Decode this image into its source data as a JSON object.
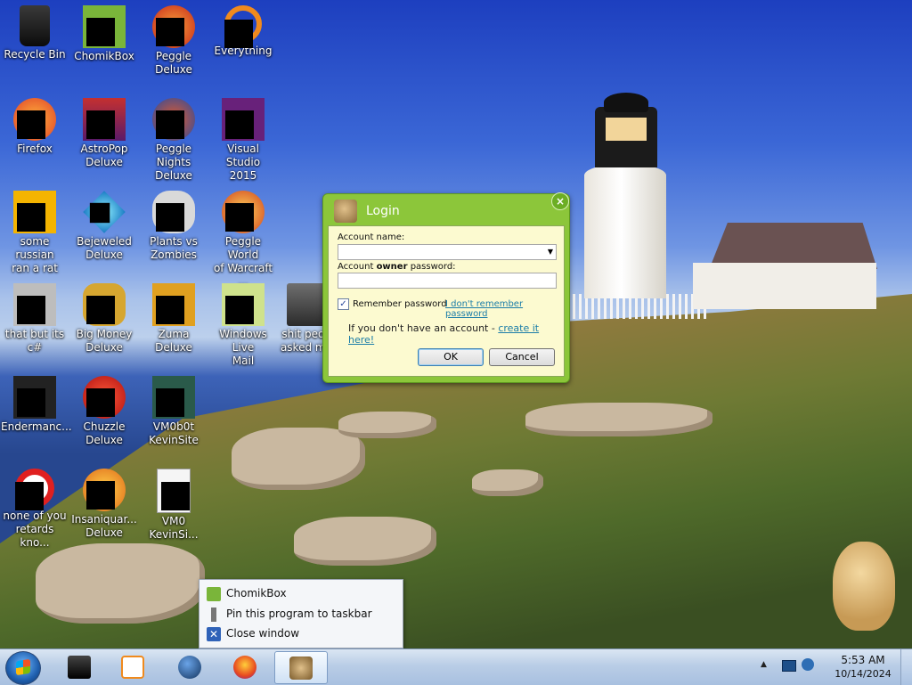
{
  "desktop_icons": [
    {
      "name": "recycle-bin",
      "label": "Recycle Bin"
    },
    {
      "name": "chomikbox",
      "label": "ChomikBox"
    },
    {
      "name": "peggle-deluxe",
      "label": "Peggle Deluxe"
    },
    {
      "name": "everything",
      "label": "Everything"
    },
    {
      "name": "firefox",
      "label": "Firefox"
    },
    {
      "name": "astropop-deluxe",
      "label": "AstroPop\nDeluxe"
    },
    {
      "name": "peggle-nights-deluxe",
      "label": "Peggle Nights\nDeluxe"
    },
    {
      "name": "visual-studio-2015",
      "label": "Visual Studio\n2015"
    },
    {
      "name": "some-russian-ran-a-rat",
      "label": "some russian\nran a rat"
    },
    {
      "name": "bejeweled-deluxe",
      "label": "Bejeweled\nDeluxe"
    },
    {
      "name": "plants-vs-zombies",
      "label": "Plants vs\nZombies"
    },
    {
      "name": "peggle-world-of-warcraft",
      "label": "Peggle World\nof Warcraft ..."
    },
    {
      "name": "that-but-its-csharp",
      "label": "that but its c#"
    },
    {
      "name": "big-money-deluxe",
      "label": "Big Money\nDeluxe"
    },
    {
      "name": "zuma-deluxe",
      "label": "Zuma Deluxe"
    },
    {
      "name": "windows-live-mail",
      "label": "Windows Live\nMail"
    },
    {
      "name": "shit-people-asked-me",
      "label": "shit peo...\nasked m..."
    },
    {
      "name": "endermanc",
      "label": "Endermanc..."
    },
    {
      "name": "chuzzle-deluxe",
      "label": "Chuzzle\nDeluxe"
    },
    {
      "name": "vm0b0t-kevinsite",
      "label": "VM0b0t\nKevinSite"
    },
    {
      "name": "none-of-you-retards-kno",
      "label": "none of you\nretards kno..."
    },
    {
      "name": "insaniquarium-deluxe",
      "label": "Insaniquar...\nDeluxe"
    },
    {
      "name": "vm0-kevinsi",
      "label": "VM0\nKevinSi..."
    }
  ],
  "login": {
    "title": "Login",
    "close": "x",
    "account_name_label": "Account name:",
    "account_name_value": "",
    "password_label_pre": "Account ",
    "password_label_bold": "owner",
    "password_label_post": " password:",
    "password_value": "",
    "remember_checked": true,
    "remember_label": "Remember password",
    "forgot_link": "I don't remember password",
    "no_account_text": "If you don't have an account - ",
    "create_link": "create it here!",
    "ok_label": "OK",
    "cancel_label": "Cancel",
    "accent_color": "#8cc63a"
  },
  "jumplist": {
    "items": [
      {
        "label": "ChomikBox",
        "icon": "chomikbox-icon"
      },
      {
        "label": "Pin this program to taskbar",
        "icon": "pin-icon"
      },
      {
        "label": "Close window",
        "icon": "close-window-icon"
      }
    ]
  },
  "taskbar": {
    "pinned": [
      "media-player-icon",
      "windows-media-center-icon",
      "globe-icon",
      "firefox-icon",
      "chomikbox-icon"
    ],
    "active": "chomikbox-icon",
    "time": "5:53 AM",
    "date": "10/14/2024",
    "tray_expand": "▲"
  }
}
